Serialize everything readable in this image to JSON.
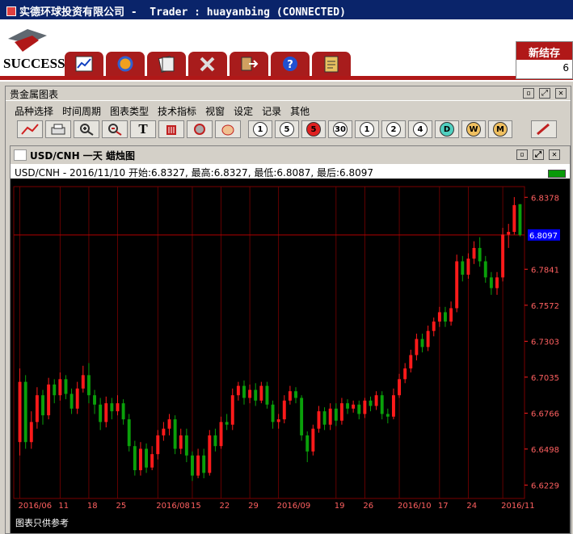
{
  "titlebar": {
    "text": "实德环球投资有限公司 -  Trader : huayanbing (CONNECTED)"
  },
  "logo": {
    "text": "SUCCESS"
  },
  "toolbar_buttons": [
    "chart-icon",
    "refresh-icon",
    "documents-icon",
    "tools-icon",
    "exit-icon",
    "help-icon",
    "clipboard-icon"
  ],
  "newbox": {
    "title": "新结存",
    "value": "6"
  },
  "panel": {
    "title": "贵金属图表"
  },
  "menu": [
    "品种选择",
    "时间周期",
    "图表类型",
    "技术指标",
    "视窗",
    "设定",
    "记录",
    "其他"
  ],
  "chart_tools": {
    "period_buttons": [
      "1",
      "5",
      "5",
      "30",
      "1",
      "2",
      "4",
      "D",
      "W",
      "M"
    ],
    "text_tool": "T"
  },
  "chart_window": {
    "title": "USD/CNH 一天 蜡烛图",
    "info": "USD/CNH - 2016/11/10 开始:6.8327, 最高:6.8327, 最低:6.8087, 最后:6.8097",
    "disclaimer": "图表只供参考"
  },
  "colors": {
    "up": "#ff1a1a",
    "down": "#0aa00a",
    "grid": "#7a0000",
    "axis": "#ff2020",
    "label": "#ff6060",
    "current": "#0000ff"
  },
  "chart_data": {
    "type": "candlestick",
    "y_ticks": [
      "6.8378",
      "6.7841",
      "6.7572",
      "6.7303",
      "6.7035",
      "6.6766",
      "6.6498",
      "6.6229"
    ],
    "y_range": [
      6.6129,
      6.8458
    ],
    "current_price": "6.8097",
    "x_ticks": [
      {
        "label": "2016/06",
        "i": 0
      },
      {
        "label": "11",
        "i": 7
      },
      {
        "label": "18",
        "i": 12
      },
      {
        "label": "25",
        "i": 17
      },
      {
        "label": "2016/08",
        "i": 24
      },
      {
        "label": "15",
        "i": 30
      },
      {
        "label": "22",
        "i": 35
      },
      {
        "label": "29",
        "i": 40
      },
      {
        "label": "2016/09",
        "i": 45
      },
      {
        "label": "19",
        "i": 55
      },
      {
        "label": "26",
        "i": 60
      },
      {
        "label": "2016/10",
        "i": 66
      },
      {
        "label": "17",
        "i": 73
      },
      {
        "label": "24",
        "i": 78
      },
      {
        "label": "2016/11",
        "i": 84
      }
    ],
    "candles": [
      [
        6.655,
        6.7,
        6.71,
        6.645
      ],
      [
        6.7,
        6.655,
        6.705,
        6.65
      ],
      [
        6.655,
        6.67,
        6.678,
        6.65
      ],
      [
        6.67,
        6.69,
        6.696,
        6.665
      ],
      [
        6.69,
        6.675,
        6.694,
        6.668
      ],
      [
        6.675,
        6.698,
        6.703,
        6.672
      ],
      [
        6.698,
        6.69,
        6.702,
        6.684
      ],
      [
        6.69,
        6.702,
        6.707,
        6.686
      ],
      [
        6.702,
        6.691,
        6.705,
        6.687
      ],
      [
        6.691,
        6.68,
        6.695,
        6.676
      ],
      [
        6.68,
        6.695,
        6.7,
        6.676
      ],
      [
        6.695,
        6.705,
        6.712,
        6.692
      ],
      [
        6.705,
        6.69,
        6.714,
        6.684
      ],
      [
        6.69,
        6.683,
        6.694,
        6.676
      ],
      [
        6.683,
        6.67,
        6.688,
        6.664
      ],
      [
        6.67,
        6.684,
        6.689,
        6.666
      ],
      [
        6.684,
        6.678,
        6.688,
        6.672
      ],
      [
        6.678,
        6.684,
        6.69,
        6.675
      ],
      [
        6.684,
        6.672,
        6.687,
        6.668
      ],
      [
        6.672,
        6.652,
        6.676,
        6.648
      ],
      [
        6.652,
        6.634,
        6.656,
        6.63
      ],
      [
        6.634,
        6.65,
        6.655,
        6.63
      ],
      [
        6.65,
        6.636,
        6.654,
        6.632
      ],
      [
        6.636,
        6.646,
        6.652,
        6.634
      ],
      [
        6.646,
        6.66,
        6.664,
        6.642
      ],
      [
        6.66,
        6.665,
        6.67,
        6.656
      ],
      [
        6.665,
        6.672,
        6.676,
        6.66
      ],
      [
        6.672,
        6.65,
        6.675,
        6.646
      ],
      [
        6.65,
        6.66,
        6.665,
        6.646
      ],
      [
        6.66,
        6.645,
        6.665,
        6.64
      ],
      [
        6.645,
        6.63,
        6.648,
        6.626
      ],
      [
        6.63,
        6.645,
        6.65,
        6.628
      ],
      [
        6.645,
        6.632,
        6.65,
        6.628
      ],
      [
        6.632,
        6.66,
        6.664,
        6.63
      ],
      [
        6.66,
        6.652,
        6.665,
        6.648
      ],
      [
        6.652,
        6.67,
        6.674,
        6.65
      ],
      [
        6.67,
        6.668,
        6.676,
        6.664
      ],
      [
        6.668,
        6.69,
        6.695,
        6.664
      ],
      [
        6.69,
        6.697,
        6.7,
        6.686
      ],
      [
        6.697,
        6.688,
        6.701,
        6.683
      ],
      [
        6.688,
        6.694,
        6.698,
        6.684
      ],
      [
        6.694,
        6.686,
        6.699,
        6.682
      ],
      [
        6.686,
        6.697,
        6.7,
        6.684
      ],
      [
        6.697,
        6.683,
        6.7,
        6.68
      ],
      [
        6.683,
        6.67,
        6.686,
        6.665
      ],
      [
        6.67,
        6.672,
        6.676,
        6.665
      ],
      [
        6.672,
        6.686,
        6.69,
        6.669
      ],
      [
        6.686,
        6.693,
        6.697,
        6.683
      ],
      [
        6.693,
        6.688,
        6.696,
        6.684
      ],
      [
        6.688,
        6.66,
        6.69,
        6.656
      ],
      [
        6.66,
        6.648,
        6.663,
        6.64
      ],
      [
        6.648,
        6.665,
        6.668,
        6.645
      ],
      [
        6.665,
        6.678,
        6.682,
        6.662
      ],
      [
        6.678,
        6.668,
        6.681,
        6.664
      ],
      [
        6.668,
        6.68,
        6.684,
        6.664
      ],
      [
        6.68,
        6.671,
        6.684,
        6.667
      ],
      [
        6.671,
        6.684,
        6.688,
        6.668
      ],
      [
        6.684,
        6.68,
        6.687,
        6.676
      ],
      [
        6.68,
        6.683,
        6.686,
        6.677
      ],
      [
        6.683,
        6.676,
        6.686,
        6.672
      ],
      [
        6.676,
        6.686,
        6.688,
        6.673
      ],
      [
        6.686,
        6.682,
        6.689,
        6.678
      ],
      [
        6.682,
        6.69,
        6.693,
        6.679
      ],
      [
        6.69,
        6.676,
        6.693,
        6.672
      ],
      [
        6.676,
        6.674,
        6.68,
        6.669
      ],
      [
        6.674,
        6.69,
        6.695,
        6.672
      ],
      [
        6.69,
        6.702,
        6.706,
        6.688
      ],
      [
        6.702,
        6.71,
        6.714,
        6.699
      ],
      [
        6.71,
        6.72,
        6.724,
        6.707
      ],
      [
        6.72,
        6.732,
        6.736,
        6.716
      ],
      [
        6.732,
        6.726,
        6.736,
        6.722
      ],
      [
        6.726,
        6.738,
        6.742,
        6.723
      ],
      [
        6.738,
        6.745,
        6.748,
        6.734
      ],
      [
        6.745,
        6.752,
        6.756,
        6.741
      ],
      [
        6.752,
        6.745,
        6.756,
        6.741
      ],
      [
        6.745,
        6.755,
        6.76,
        6.742
      ],
      [
        6.755,
        6.79,
        6.795,
        6.752
      ],
      [
        6.79,
        6.78,
        6.794,
        6.775
      ],
      [
        6.78,
        6.792,
        6.796,
        6.777
      ],
      [
        6.792,
        6.8,
        6.805,
        6.788
      ],
      [
        6.8,
        6.79,
        6.808,
        6.786
      ],
      [
        6.79,
        6.778,
        6.794,
        6.774
      ],
      [
        6.778,
        6.77,
        6.782,
        6.765
      ],
      [
        6.77,
        6.778,
        6.782,
        6.765
      ],
      [
        6.778,
        6.81,
        6.815,
        6.775
      ],
      [
        6.81,
        6.812,
        6.818,
        6.8
      ],
      [
        6.812,
        6.832,
        6.838,
        6.81
      ],
      [
        6.8327,
        6.8097,
        6.8327,
        6.8087
      ]
    ]
  }
}
